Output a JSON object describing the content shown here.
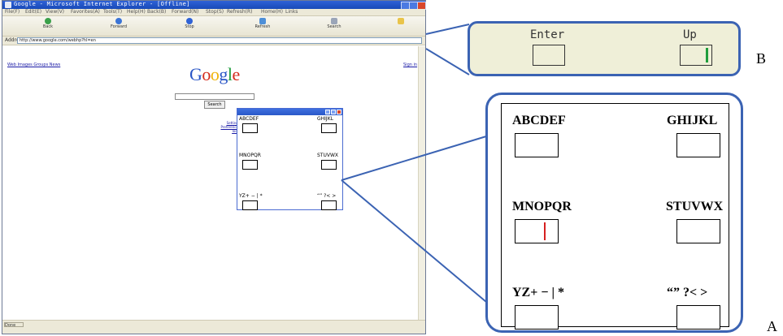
{
  "browser": {
    "title": "Google - Microsoft Internet Explorer - [Offline]",
    "menu": [
      "File(F)",
      "Edit(E)",
      "View(V)",
      "Favorites(A)",
      "Tools(T)",
      "Help(H)",
      "Back(B)",
      "Forward(N)",
      "Stop(S)",
      "Refresh(R)",
      "Home(H)",
      "Links"
    ],
    "toolbar": [
      "Back",
      "Forward",
      "Stop",
      "Refresh",
      "Search"
    ],
    "address_label": "Address",
    "address": "http://www.google.com/webhp?hl=en",
    "status": "Done"
  },
  "google": {
    "top_links": "Web Images Groups News",
    "sign_in": "Sign in",
    "logo_letters": [
      "G",
      "o",
      "o",
      "g",
      "l",
      "e"
    ],
    "search_button": "Search",
    "side_links": [
      "Settings",
      "Preferences",
      "Tools"
    ]
  },
  "popup": {
    "keys": [
      "ABCDEF",
      "GHIJKL",
      "MNOPQR",
      "STUVWX",
      "YZ+ − | *",
      "“”  ?< >"
    ]
  },
  "panelB": {
    "enter_label": "Enter",
    "up_label": "Up",
    "marker": "B"
  },
  "panelA": {
    "keys": [
      "ABCDEF",
      "GHIJKL",
      "MNOPQR",
      "STUVWX",
      "YZ+ − | *",
      "“”   ?< >"
    ],
    "marker": "A"
  },
  "colors": {
    "accent": "#3b63b3",
    "panel_b_bg": "#efefd8",
    "cursor_red": "#d62020",
    "cursor_green": "#1f9d3c",
    "google": [
      "#2a56c6",
      "#d42a1c",
      "#efb30c",
      "#2a56c6",
      "#1f9d3c",
      "#d42a1c"
    ]
  }
}
